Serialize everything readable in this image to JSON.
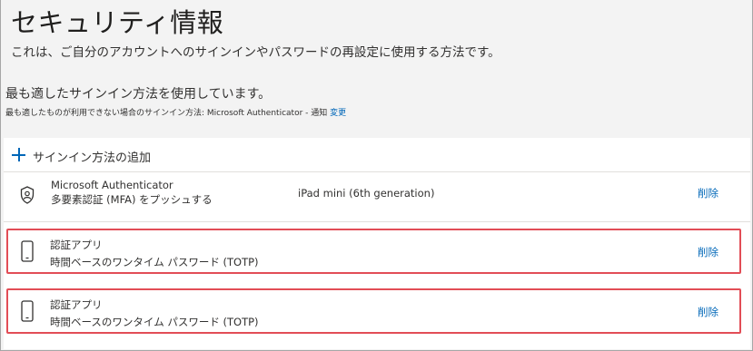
{
  "header": {
    "title": "セキュリティ情報",
    "subtitle": "これは、ご自分のアカウントへのサインインやパスワードの再設定に使用する方法です。"
  },
  "default_method": {
    "heading": "最も適したサインイン方法を使用しています。",
    "fallback_prefix": "最も適したものが利用できない場合のサインイン方法: Microsoft Authenticator - 通知",
    "change_link": "変更"
  },
  "add_method": {
    "label": "サインイン方法の追加",
    "icon": "plus-icon"
  },
  "methods": [
    {
      "icon": "authenticator-icon",
      "name": "Microsoft Authenticator",
      "description": "多要素認証 (MFA) をプッシュする",
      "device": "iPad mini (6th generation)",
      "delete_label": "削除"
    },
    {
      "icon": "phone-icon",
      "name": "認証アプリ",
      "description": "時間ベースのワンタイム パスワード (TOTP)",
      "delete_label": "削除",
      "highlighted": true
    },
    {
      "icon": "phone-icon",
      "name": "認証アプリ",
      "description": "時間ベースのワンタイム パスワード (TOTP)",
      "delete_label": "削除",
      "highlighted": true
    }
  ],
  "colors": {
    "link": "#0067b8",
    "highlight_border": "#e24d56",
    "background": "#f3f3f3",
    "panel": "#ffffff"
  }
}
